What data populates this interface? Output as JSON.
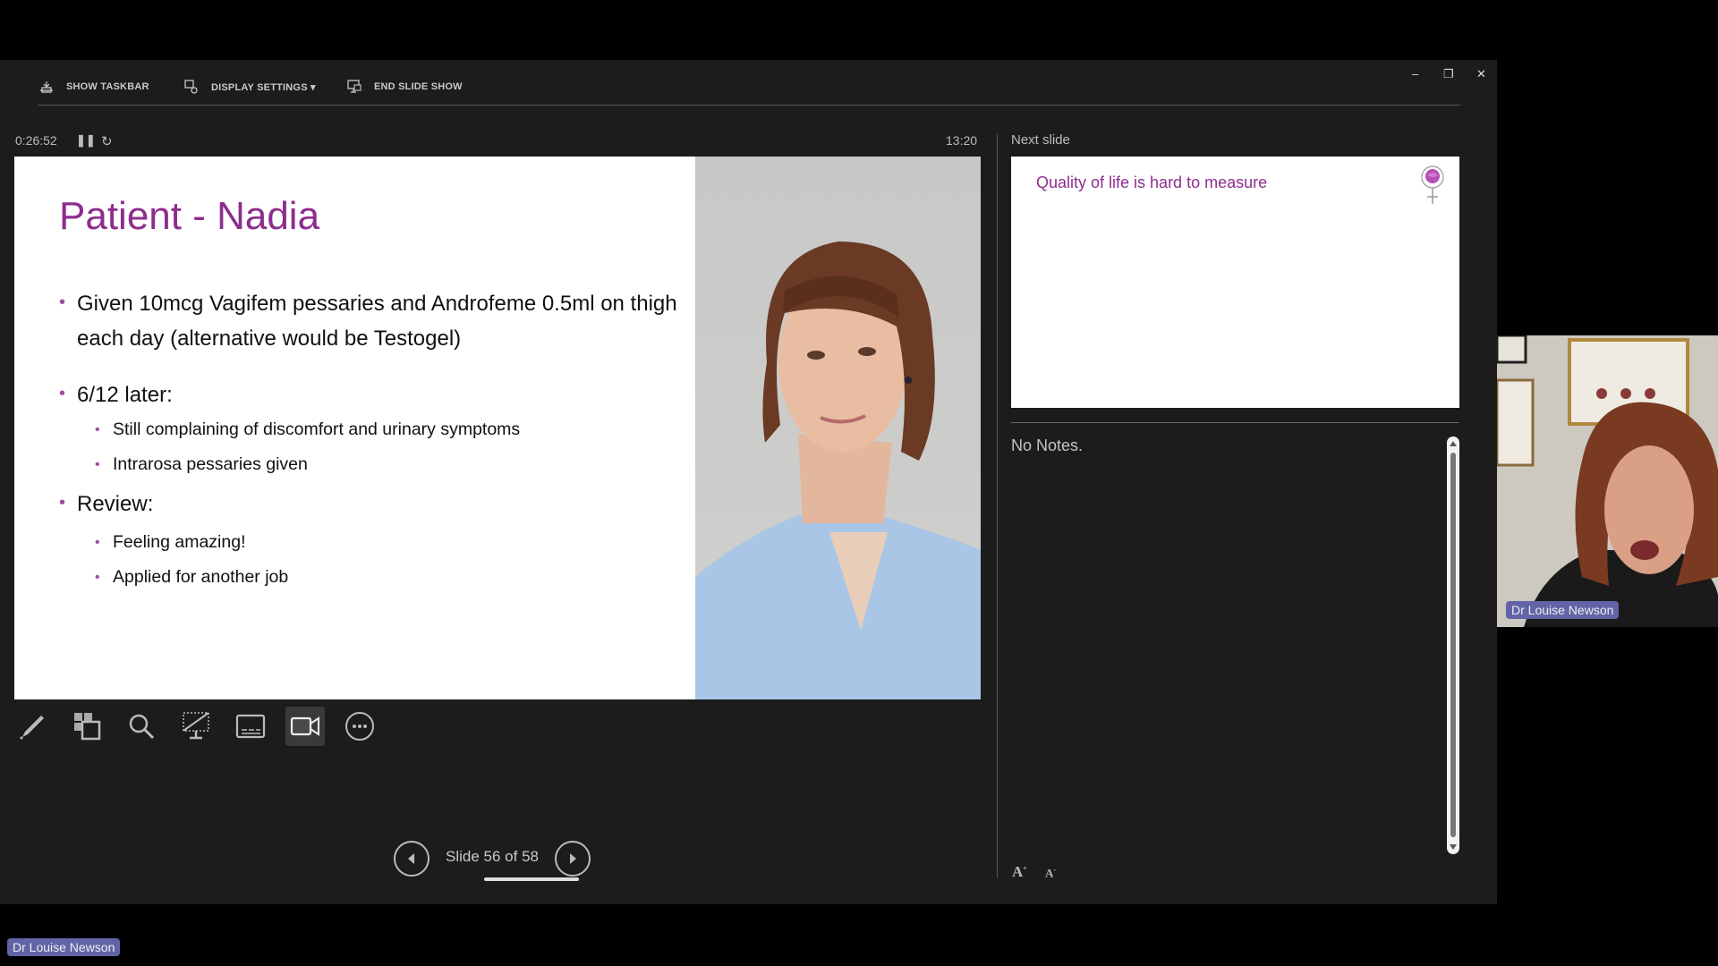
{
  "toolbar": {
    "show_taskbar": "SHOW TASKBAR",
    "display_settings": "DISPLAY SETTINGS ▾",
    "end_slide_show": "END SLIDE SHOW"
  },
  "window_controls": {
    "minimize": "–",
    "restore": "❐",
    "close": "✕"
  },
  "presenter": {
    "elapsed_time": "0:26:52",
    "clock": "13:20",
    "next_slide_label": "Next slide",
    "notes_text": "No Notes.",
    "slide_counter": "Slide 56 of 58",
    "current_slide": 56,
    "total_slides": 58,
    "font_increase": "A",
    "font_decrease": "A"
  },
  "current_slide": {
    "title": "Patient - Nadia",
    "bullets": [
      {
        "level": 1,
        "text": "Given 10mcg Vagifem pessaries and Androfeme 0.5ml on thigh each day (alternative would be Testogel)"
      },
      {
        "level": 1,
        "text": "6/12 later:"
      },
      {
        "level": 2,
        "text": "Still complaining of discomfort and urinary symptoms"
      },
      {
        "level": 2,
        "text": "Intrarosa pessaries given"
      },
      {
        "level": 1,
        "text": "Review:"
      },
      {
        "level": 2,
        "text": "Feeling amazing!"
      },
      {
        "level": 2,
        "text": "Applied for another job"
      }
    ]
  },
  "next_slide": {
    "title": "Quality of life is hard to measure"
  },
  "participants": {
    "video_name": "Dr Louise Newson",
    "screen_share_name": "Dr Louise Newson"
  },
  "colors": {
    "accent": "#8e2d8e",
    "name_tag": "#6264a7",
    "background": "#1c1c1c"
  }
}
